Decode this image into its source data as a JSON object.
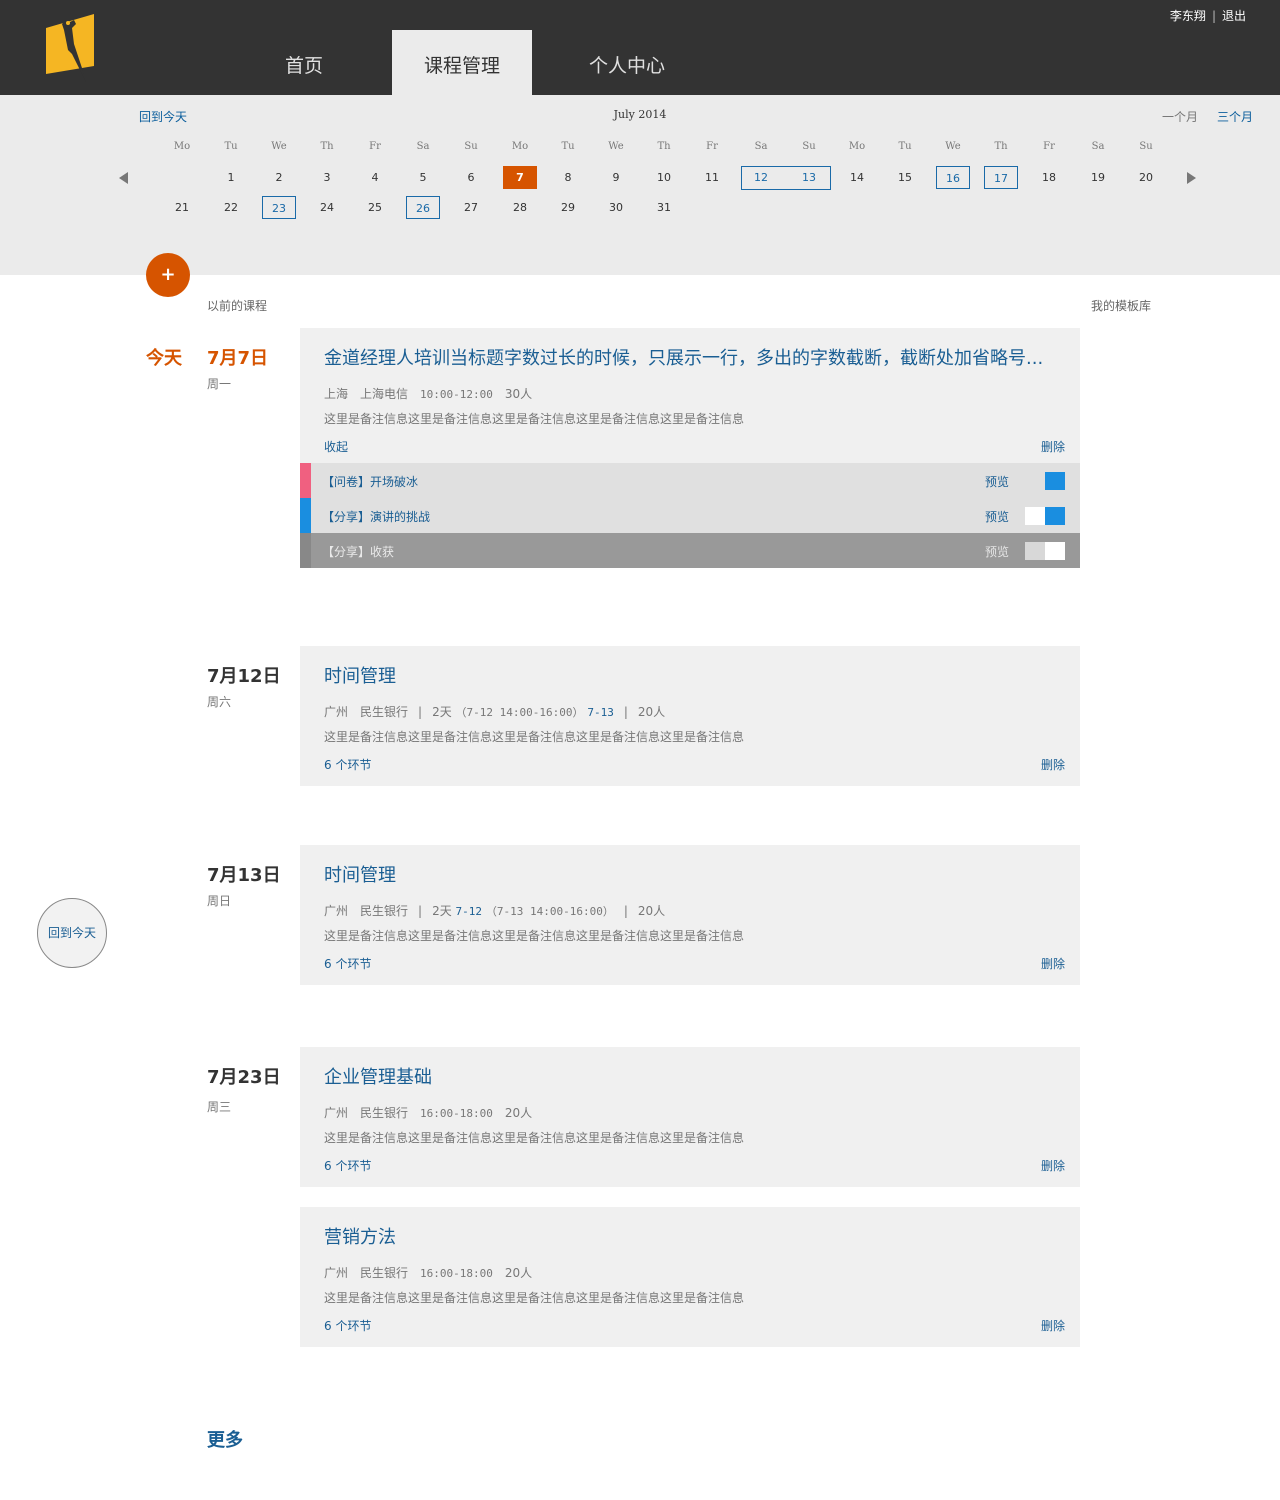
{
  "header": {
    "nav": [
      {
        "label": "首页",
        "active": false
      },
      {
        "label": "课程管理",
        "active": true
      },
      {
        "label": "个人中心",
        "active": false
      }
    ],
    "user": "李东翔",
    "logout": "退出"
  },
  "calendar": {
    "back_today": "回到今天",
    "title": "July 2014",
    "range_one": "一个月",
    "range_three": "三个月",
    "weekdays": [
      "Mo",
      "Tu",
      "We",
      "Th",
      "Fr",
      "Sa",
      "Su",
      "Mo",
      "Tu",
      "We",
      "Th",
      "Fr",
      "Sa",
      "Su",
      "Mo",
      "Tu",
      "We",
      "Th",
      "Fr",
      "Sa",
      "Su"
    ],
    "row1": [
      "1",
      "2",
      "3",
      "4",
      "5",
      "6",
      "7",
      "8",
      "9",
      "10",
      "11",
      "12",
      "13",
      "14",
      "15",
      "16",
      "17",
      "18",
      "19",
      "20"
    ],
    "row2": [
      "21",
      "22",
      "23",
      "24",
      "25",
      "26",
      "27",
      "28",
      "29",
      "30",
      "31"
    ],
    "today_day": "7",
    "marked_days": [
      "12",
      "13",
      "16",
      "17",
      "23",
      "26"
    ]
  },
  "toolbar": {
    "add": "+",
    "past_courses": "以前的课程",
    "template_lib": "我的模板库"
  },
  "groups": [
    {
      "today": "今天",
      "date": "7月7日",
      "weekday": "周一"
    },
    {
      "today": "",
      "date": "7月12日",
      "weekday": "周六"
    },
    {
      "today": "",
      "date": "7月13日",
      "weekday": "周日"
    },
    {
      "today": "",
      "date": "7月23日",
      "weekday": "周三"
    }
  ],
  "courses": [
    {
      "title": "金道经理人培训当标题字数过长的时候，只展示一行，多出的字数截断，截断处加省略号...",
      "city": "上海",
      "org": "上海电信",
      "time": "10:00-12:00",
      "people": "30人",
      "note": "这里是备注信息这里是备注信息这里是备注信息这里是备注信息这里是备注信息",
      "link": "收起",
      "delete": "删除"
    },
    {
      "title": "时间管理",
      "city": "广州",
      "org": "民生银行",
      "days": "2天",
      "seg1": "（7-12 14:00-16:00）",
      "seg2": "7-13",
      "people": "20人",
      "note": "这里是备注信息这里是备注信息这里是备注信息这里是备注信息这里是备注信息",
      "link": "6 个环节",
      "delete": "删除"
    },
    {
      "title": "时间管理",
      "city": "广州",
      "org": "民生银行",
      "days": "2天",
      "seg1": "7-12",
      "seg2": "（7-13 14:00-16:00）",
      "people": "20人",
      "note": "这里是备注信息这里是备注信息这里是备注信息这里是备注信息这里是备注信息",
      "link": "6 个环节",
      "delete": "删除"
    },
    {
      "title": "企业管理基础",
      "city": "广州",
      "org": "民生银行",
      "time": "16:00-18:00",
      "people": "20人",
      "note": "这里是备注信息这里是备注信息这里是备注信息这里是备注信息这里是备注信息",
      "link": "6 个环节",
      "delete": "删除"
    },
    {
      "title": "营销方法",
      "city": "广州",
      "org": "民生银行",
      "time": "16:00-18:00",
      "people": "20人",
      "note": "这里是备注信息这里是备注信息这里是备注信息这里是备注信息这里是备注信息",
      "link": "6 个环节",
      "delete": "删除"
    }
  ],
  "sessions": [
    {
      "label": "【问卷】开场破冰",
      "preview": "预览",
      "stripe_color": "#f06080",
      "enabled": true
    },
    {
      "label": "【分享】演讲的挑战",
      "preview": "预览",
      "stripe_color": "#1a8ee0",
      "enabled": true
    },
    {
      "label": "【分享】收获",
      "preview": "预览",
      "stripe_color": "#888888",
      "enabled": false
    }
  ],
  "floating": {
    "back_today": "回到今天"
  },
  "more": "更多",
  "colors": {
    "accent": "#d65400",
    "link": "#1a5e93",
    "header": "#333333"
  }
}
